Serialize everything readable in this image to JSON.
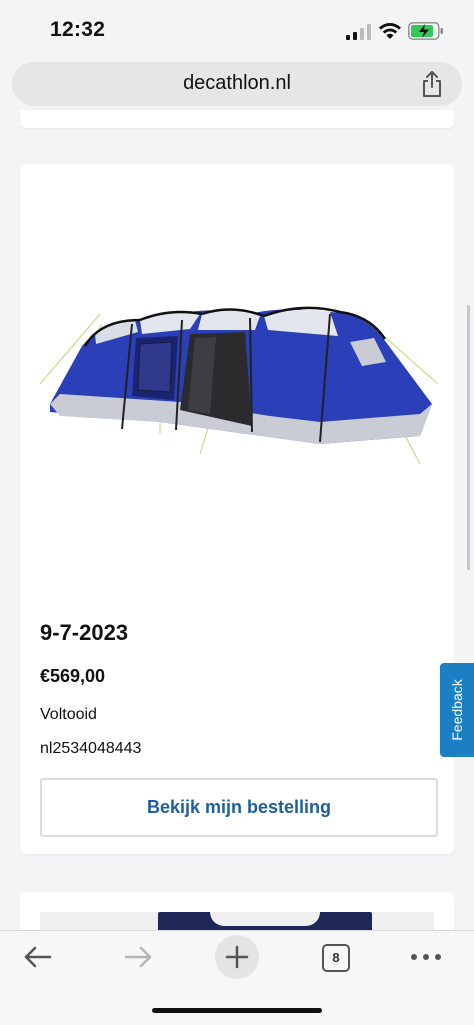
{
  "status_bar": {
    "time": "12:32"
  },
  "browser": {
    "url": "decathlon.nl",
    "open_tab_count": "8"
  },
  "order": {
    "date": "9-7-2023",
    "price": "€569,00",
    "status": "Voltooid",
    "order_number": "nl2534048443",
    "view_button_label": "Bekijk mijn bestelling"
  },
  "feedback": {
    "label": "Feedback"
  },
  "colors": {
    "accent_blue": "#1d5fa0",
    "feedback_blue": "#1b7fc4",
    "tent_blue": "#2a3fb8"
  },
  "icons": {
    "share": "share-icon",
    "back": "arrow-left-icon",
    "forward": "arrow-right-icon",
    "new_tab": "plus-icon",
    "more": "more-dots-icon"
  }
}
